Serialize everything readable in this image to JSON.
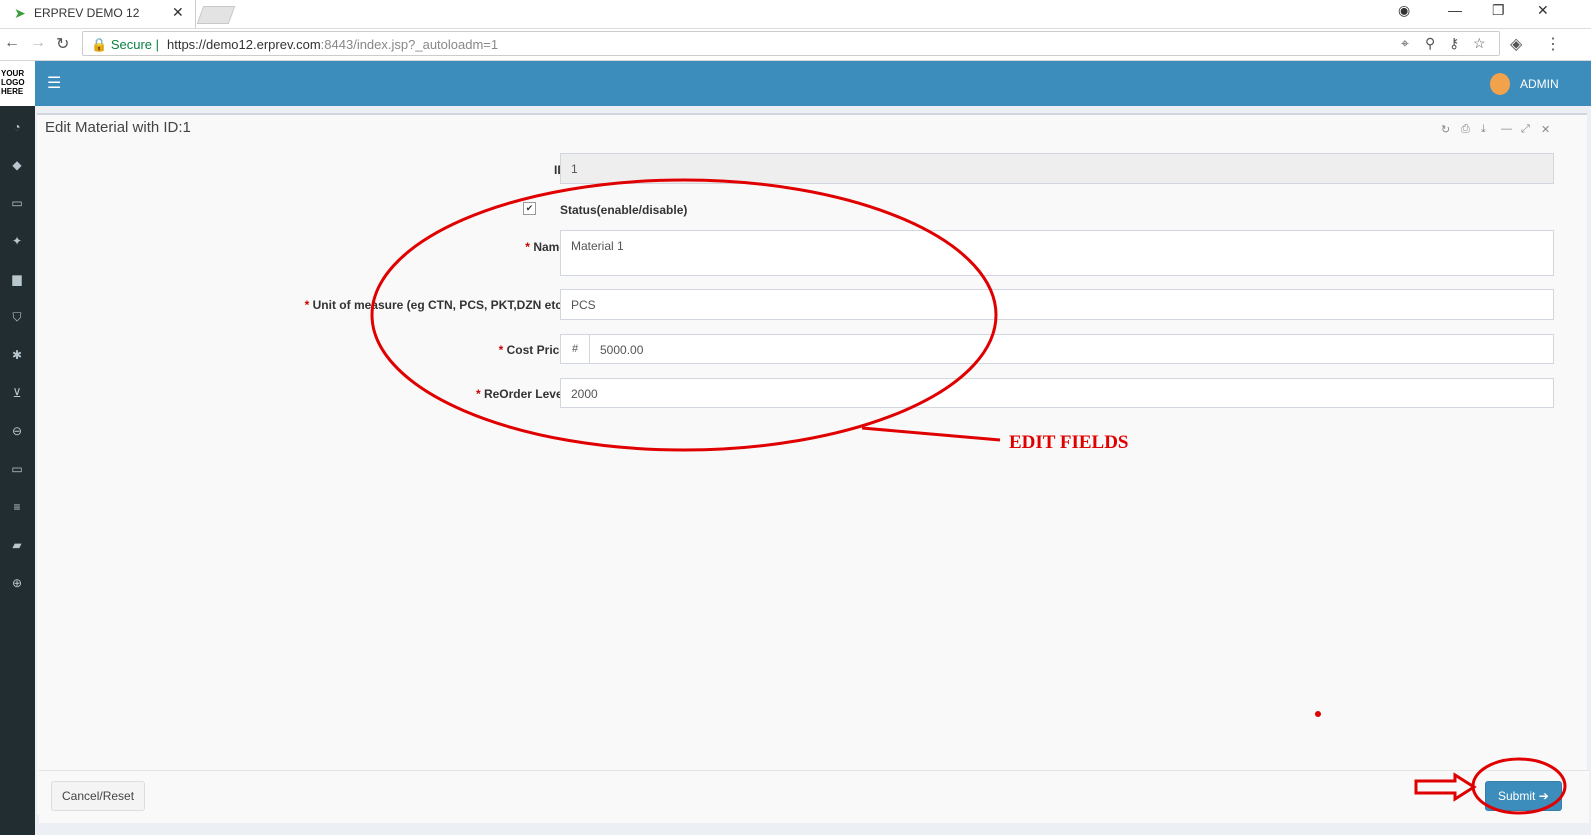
{
  "browser": {
    "tab_title": "ERPREV DEMO 12",
    "tab_close": "✕",
    "secure_label": "Secure",
    "url_host": "https://demo12.erprev.com",
    "url_rest": ":8443/index.jsp?_autoloadm=1"
  },
  "header": {
    "logo_text": "YOUR LOGO HERE",
    "user_name": "ADMIN"
  },
  "sidebar_icons": [
    "dashboard-icon",
    "tag-icon",
    "money-icon",
    "cubes-icon",
    "building-icon",
    "shield-icon",
    "snowflake-icon",
    "cart-icon",
    "minus-circle-icon",
    "monitor-icon",
    "database-icon",
    "book-icon",
    "lifebuoy-icon"
  ],
  "form": {
    "title": "Edit Material with ID:1",
    "id_label": "ID:",
    "id_value": "1",
    "status_label": "Status(enable/disable)",
    "status_checked": true,
    "name_label": "Name:",
    "name_value": "Material 1",
    "unit_label": "Unit of measure (eg CTN, PCS, PKT,DZN etc):",
    "unit_value": "PCS",
    "cost_label": "Cost Price:",
    "cost_prefix": "#",
    "cost_value": "5000.00",
    "reorder_label": "ReOrder Level:",
    "reorder_value": "2000",
    "required_marker": "*",
    "cancel_label": "Cancel/Reset",
    "submit_label": "Submit"
  },
  "annotation": {
    "text": "EDIT FIELDS",
    "color": "#e00000"
  },
  "colors": {
    "header": "#3c8dbc",
    "sidebar": "#222d32"
  }
}
